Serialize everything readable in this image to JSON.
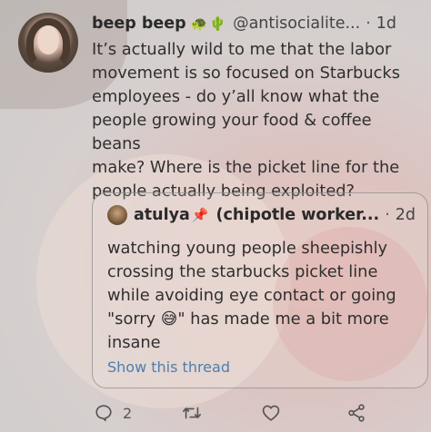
{
  "tweet": {
    "author_name": "beep beep",
    "emoji": [
      "🐢",
      "🌵"
    ],
    "handle": "@antisocialite...",
    "separator": "·",
    "time": "1d",
    "text": "It’s actually wild to me that the labor\nmovement is so focused on Starbucks\nemployees - do y’all know what the\npeople growing your food & coffee beans\nmake? Where is the picket line for the\npeople actually being exploited?"
  },
  "quote": {
    "author_name": "atulya",
    "pin_emoji": "📌",
    "display": "(chipotle worker...",
    "separator": "·",
    "time": "2d",
    "text": "watching young people sheepishly\ncrossing the starbucks picket line\nwhile avoiding eye contact or going\n\"sorry 😅\" has made me a bit more\ninsane",
    "show_thread": "Show this thread"
  },
  "actions": {
    "reply_count": "2",
    "retweet_count": "",
    "like_count": "",
    "icons": [
      "reply-icon",
      "retweet-icon",
      "like-icon",
      "share-icon"
    ]
  },
  "colors": {
    "link": "#4c7fae",
    "text": "#2f2f2f"
  }
}
